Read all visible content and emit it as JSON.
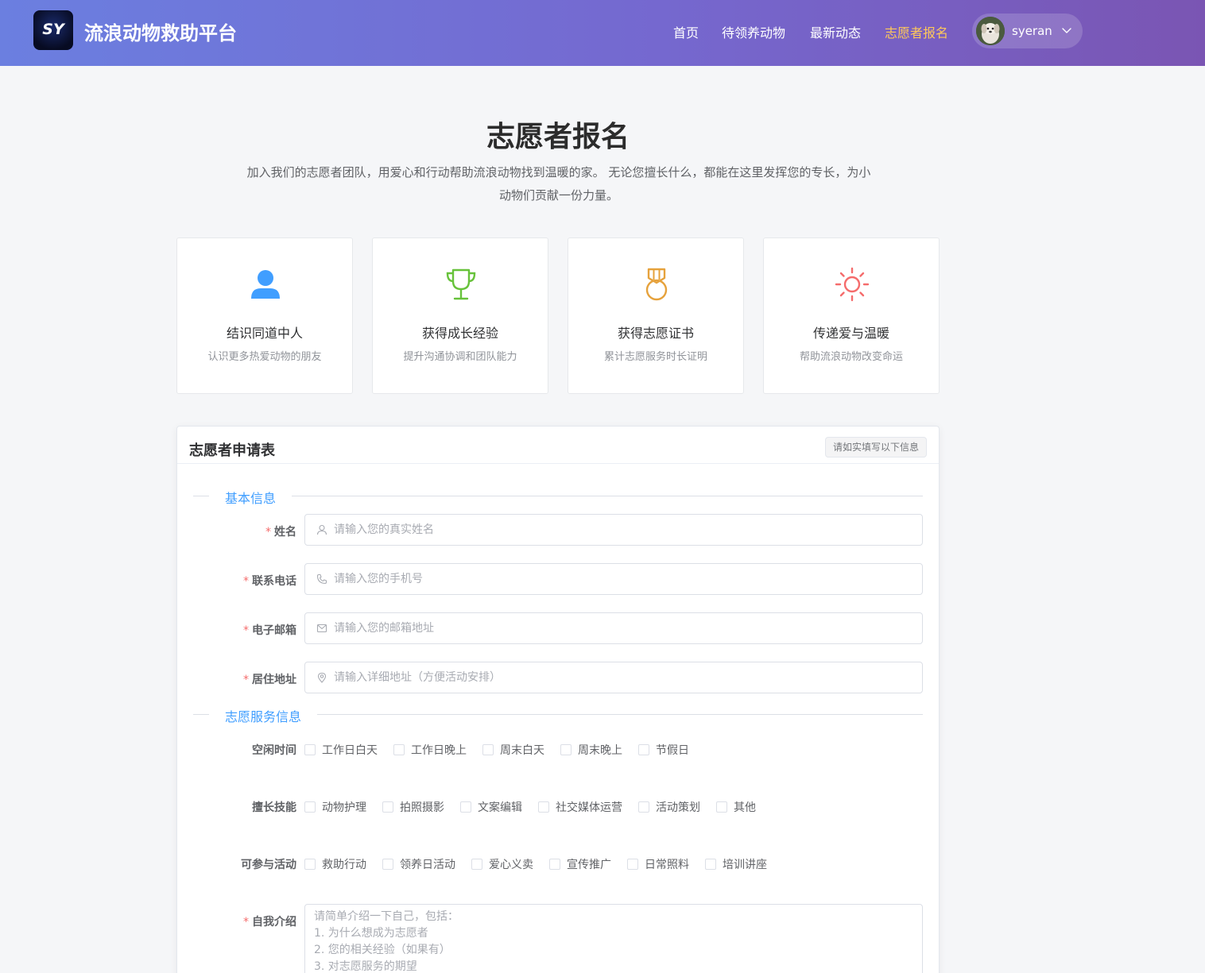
{
  "header": {
    "logo_text": "SY",
    "brand": "流浪动物救助平台",
    "nav": [
      "首页",
      "待领养动物",
      "最新动态",
      "志愿者报名"
    ],
    "active_nav": "志愿者报名",
    "username": "syeran",
    "colors": {
      "gradient_start": "#6b7fe0",
      "gradient_end": "#7a55b3",
      "active": "#ffc85a"
    }
  },
  "hero": {
    "title": "志愿者报名",
    "intro": "加入我们的志愿者团队，用爱心和行动帮助流浪动物找到温暖的家。 无论您擅长什么，都能在这里发挥您的专长，为小动物们贡献一份力量。"
  },
  "features": [
    {
      "icon": "user-icon",
      "color": "#409eff",
      "title": "结识同道中人",
      "desc": "认识更多热爱动物的朋友"
    },
    {
      "icon": "trophy-icon",
      "color": "#67c23a",
      "title": "获得成长经验",
      "desc": "提升沟通协调和团队能力"
    },
    {
      "icon": "medal-icon",
      "color": "#e6a23c",
      "title": "获得志愿证书",
      "desc": "累计志愿服务时长证明"
    },
    {
      "icon": "sunny-icon",
      "color": "#f56c6c",
      "title": "传递爱与温暖",
      "desc": "帮助流浪动物改变命运"
    }
  ],
  "form": {
    "title": "志愿者申请表",
    "tag": "请如实填写以下信息",
    "sections": {
      "basic": "基本信息",
      "service": "志愿服务信息"
    },
    "required_mark": "*",
    "fields": {
      "name": {
        "label": "姓名",
        "placeholder": "请输入您的真实姓名",
        "value": ""
      },
      "phone": {
        "label": "联系电话",
        "placeholder": "请输入您的手机号",
        "value": ""
      },
      "email": {
        "label": "电子邮箱",
        "placeholder": "请输入您的邮箱地址",
        "value": ""
      },
      "address": {
        "label": "居住地址",
        "placeholder": "请输入详细地址（方便活动安排）",
        "value": ""
      }
    },
    "free_time": {
      "label": "空闲时间",
      "options": [
        "工作日白天",
        "工作日晚上",
        "周末白天",
        "周末晚上",
        "节假日"
      ]
    },
    "skills": {
      "label": "擅长技能",
      "options": [
        "动物护理",
        "拍照摄影",
        "文案编辑",
        "社交媒体运营",
        "活动策划",
        "其他"
      ]
    },
    "activities": {
      "label": "可参与活动",
      "options": [
        "救助行动",
        "领养日活动",
        "爱心义卖",
        "宣传推广",
        "日常照料",
        "培训讲座"
      ]
    },
    "intro": {
      "label": "自我介绍",
      "placeholder": "请简单介绍一下自己，包括：\n1. 为什么想成为志愿者\n2. 您的相关经验（如果有）\n3. 对志愿服务的期望",
      "value": ""
    }
  }
}
